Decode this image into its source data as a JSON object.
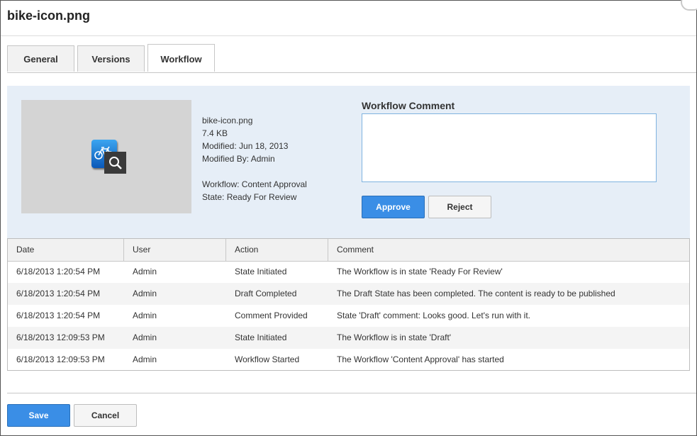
{
  "dialog": {
    "title": "bike-icon.png"
  },
  "tabs": [
    {
      "label": "General",
      "active": false
    },
    {
      "label": "Versions",
      "active": false
    },
    {
      "label": "Workflow",
      "active": true
    }
  ],
  "file_info": {
    "thumbnail_icon": "bike-icon",
    "preview_icon": "magnifier-icon",
    "name": "bike-icon.png",
    "size": "7.4 KB",
    "modified": "Modified: Jun 18, 2013",
    "modified_by": "Modified By: Admin",
    "workflow": "Workflow: Content Approval",
    "state": "State: Ready For Review"
  },
  "workflow_comment": {
    "label": "Workflow Comment",
    "value": "",
    "approve_label": "Approve",
    "reject_label": "Reject"
  },
  "history": {
    "columns": [
      "Date",
      "User",
      "Action",
      "Comment"
    ],
    "rows": [
      [
        "6/18/2013 1:20:54 PM",
        "Admin",
        "State Initiated",
        "The Workflow is in state 'Ready For Review'"
      ],
      [
        "6/18/2013 1:20:54 PM",
        "Admin",
        "Draft Completed",
        "The Draft State has been completed. The content is ready to be published"
      ],
      [
        "6/18/2013 1:20:54 PM",
        "Admin",
        "Comment Provided",
        "State 'Draft' comment: Looks good. Let's run with it."
      ],
      [
        "6/18/2013 12:09:53 PM",
        "Admin",
        "State Initiated",
        "The Workflow is in state 'Draft'"
      ],
      [
        "6/18/2013 12:09:53 PM",
        "Admin",
        "Workflow Started",
        "The Workflow 'Content Approval' has started"
      ]
    ]
  },
  "footer": {
    "save_label": "Save",
    "cancel_label": "Cancel"
  },
  "colors": {
    "primary": "#3a8ee6",
    "panel": "#e6eef7"
  }
}
